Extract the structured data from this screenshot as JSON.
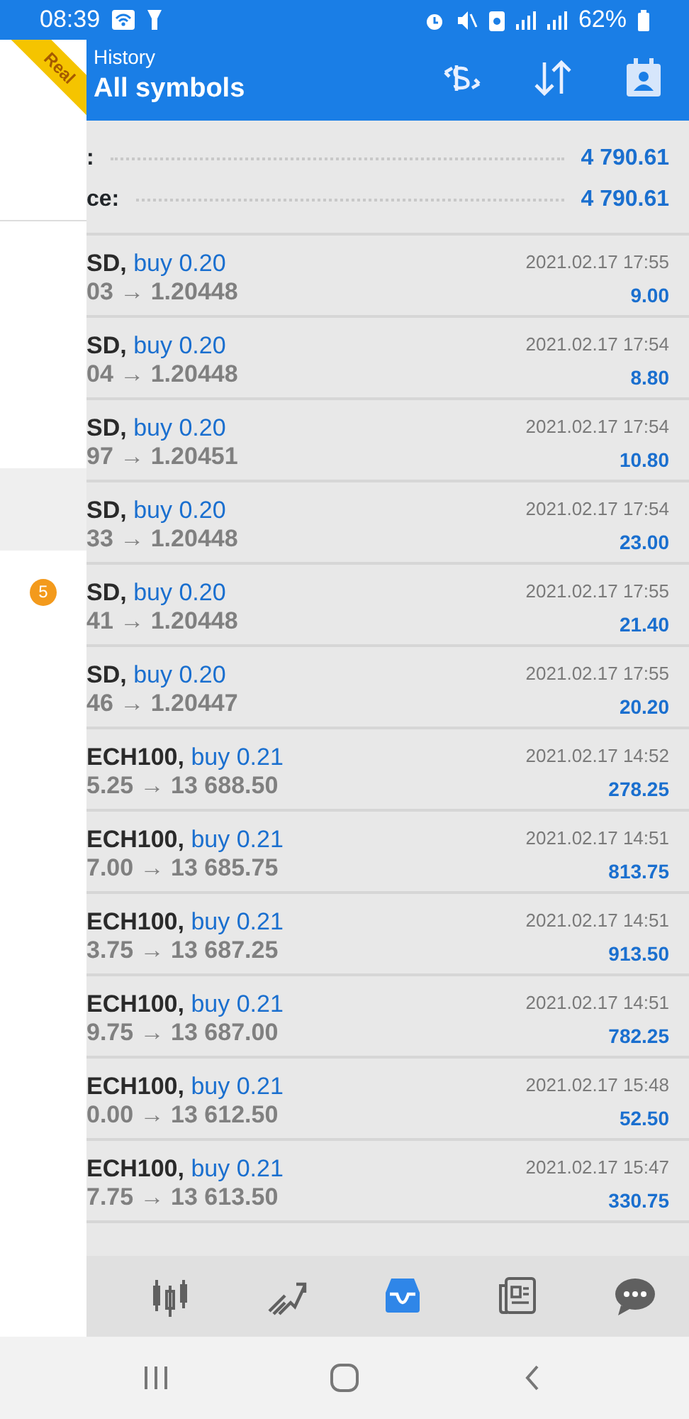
{
  "status_bar": {
    "time": "08:39",
    "battery": "62%"
  },
  "drawer": {
    "ribbon": "Real",
    "badge": "5"
  },
  "header": {
    "subtitle": "History",
    "title": "All symbols"
  },
  "summary": [
    {
      "label": ":",
      "value": "4 790.61"
    },
    {
      "label": "ce:",
      "value": "4 790.61"
    }
  ],
  "deals": [
    {
      "symbol": "SD,",
      "side": "buy 0.20",
      "prices": "03 → 1.20448",
      "time": "2021.02.17 17:55",
      "profit": "9.00"
    },
    {
      "symbol": "SD,",
      "side": "buy 0.20",
      "prices": "04 → 1.20448",
      "time": "2021.02.17 17:54",
      "profit": "8.80"
    },
    {
      "symbol": "SD,",
      "side": "buy 0.20",
      "prices": "97 → 1.20451",
      "time": "2021.02.17 17:54",
      "profit": "10.80"
    },
    {
      "symbol": "SD,",
      "side": "buy 0.20",
      "prices": "33 → 1.20448",
      "time": "2021.02.17 17:54",
      "profit": "23.00"
    },
    {
      "symbol": "SD,",
      "side": "buy 0.20",
      "prices": "41 → 1.20448",
      "time": "2021.02.17 17:55",
      "profit": "21.40"
    },
    {
      "symbol": "SD,",
      "side": "buy 0.20",
      "prices": "46 → 1.20447",
      "time": "2021.02.17 17:55",
      "profit": "20.20"
    },
    {
      "symbol": "ECH100,",
      "side": "buy 0.21",
      "prices": "5.25 → 13 688.50",
      "time": "2021.02.17 14:52",
      "profit": "278.25"
    },
    {
      "symbol": "ECH100,",
      "side": "buy 0.21",
      "prices": "7.00 → 13 685.75",
      "time": "2021.02.17 14:51",
      "profit": "813.75"
    },
    {
      "symbol": "ECH100,",
      "side": "buy 0.21",
      "prices": "3.75 → 13 687.25",
      "time": "2021.02.17 14:51",
      "profit": "913.50"
    },
    {
      "symbol": "ECH100,",
      "side": "buy 0.21",
      "prices": "9.75 → 13 687.00",
      "time": "2021.02.17 14:51",
      "profit": "782.25"
    },
    {
      "symbol": "ECH100,",
      "side": "buy 0.21",
      "prices": "0.00 → 13 612.50",
      "time": "2021.02.17 15:48",
      "profit": "52.50"
    },
    {
      "symbol": "ECH100,",
      "side": "buy 0.21",
      "prices": "7.75 → 13 613.50",
      "time": "2021.02.17 15:47",
      "profit": "330.75"
    }
  ],
  "bottom_nav": [
    {
      "kind": "chart",
      "selected": false
    },
    {
      "kind": "trade",
      "selected": false
    },
    {
      "kind": "history",
      "selected": true
    },
    {
      "kind": "news",
      "selected": false
    },
    {
      "kind": "chat",
      "selected": false
    }
  ]
}
